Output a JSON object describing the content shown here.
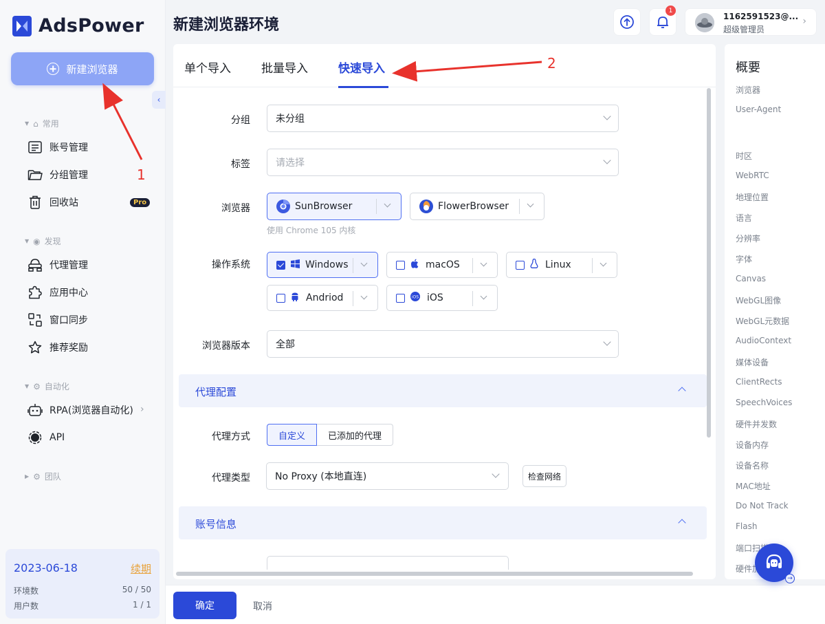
{
  "brand": {
    "name": "AdsPower"
  },
  "sidebar": {
    "new_browser_label": "新建浏览器",
    "sections": {
      "common": "常用",
      "discover": "发现",
      "automation": "自动化",
      "team": "团队"
    },
    "items": {
      "accounts": "账号管理",
      "groups": "分组管理",
      "trash": "回收站",
      "proxy": "代理管理",
      "apps": "应用中心",
      "sync": "窗口同步",
      "rewards": "推荐奖励",
      "rpa": "RPA(浏览器自动化)",
      "api": "API"
    },
    "pro_badge": "Pro",
    "info": {
      "date": "2023-06-18",
      "renew": "续期",
      "env_label": "环境数",
      "env_value": "50 / 50",
      "user_label": "用户数",
      "user_value": "1 / 1"
    }
  },
  "header": {
    "title": "新建浏览器环境",
    "notification_count": "1",
    "user_name": "1162591523@...",
    "user_role": "超级管理员"
  },
  "tabs": [
    "单个导入",
    "批量导入",
    "快速导入"
  ],
  "form": {
    "group_label": "分组",
    "group_value": "未分组",
    "tag_label": "标签",
    "tag_placeholder": "请选择",
    "browser_label": "浏览器",
    "browser_options": [
      "SunBrowser",
      "FlowerBrowser"
    ],
    "browser_hint": "使用 Chrome 105 内核",
    "os_label": "操作系统",
    "os_options": [
      "Windows",
      "macOS",
      "Linux",
      "Andriod",
      "iOS"
    ],
    "version_label": "浏览器版本",
    "version_value": "全部"
  },
  "proxy_section": {
    "title": "代理配置",
    "mode_label": "代理方式",
    "mode_options": [
      "自定义",
      "已添加的代理"
    ],
    "type_label": "代理类型",
    "type_value": "No Proxy (本地直连)",
    "check_button": "检查网络"
  },
  "account_section": {
    "title": "账号信息"
  },
  "summary": {
    "title": "概要",
    "items": [
      "浏览器",
      "User-Agent",
      "时区",
      "WebRTC",
      "地理位置",
      "语言",
      "分辨率",
      "字体",
      "Canvas",
      "WebGL图像",
      "WebGL元数据",
      "AudioContext",
      "媒体设备",
      "ClientRects",
      "SpeechVoices",
      "硬件并发数",
      "设备内存",
      "设备名称",
      "MAC地址",
      "Do Not Track",
      "Flash",
      "端口扫描",
      "硬件加速"
    ]
  },
  "footer": {
    "ok": "确定",
    "cancel": "取消"
  },
  "annotations": {
    "one": "1",
    "two": "2"
  },
  "colors": {
    "primary": "#2b49d8",
    "annotation": "#e8322c"
  }
}
